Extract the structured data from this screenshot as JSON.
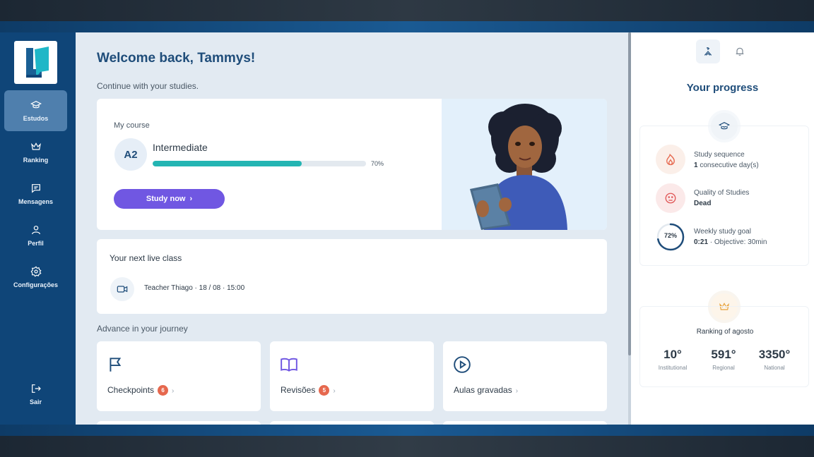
{
  "sidebar": {
    "items": [
      {
        "label": "Estudos",
        "icon": "graduation-cap-icon",
        "active": true
      },
      {
        "label": "Ranking",
        "icon": "crown-icon",
        "active": false
      },
      {
        "label": "Mensagens",
        "icon": "message-icon",
        "active": false
      },
      {
        "label": "Perfil",
        "icon": "user-icon",
        "active": false
      },
      {
        "label": "Configurações",
        "icon": "gear-icon",
        "active": false
      }
    ],
    "logout": {
      "label": "Sair",
      "icon": "logout-icon"
    }
  },
  "main": {
    "welcome": "Welcome back, Tammys!",
    "subtitle": "Continue with your studies.",
    "course": {
      "label": "My course",
      "level_code": "A2",
      "level_name": "Intermediate",
      "progress": 70,
      "progress_label": "70%",
      "cta": "Study now"
    },
    "live_class": {
      "title": "Your next live class",
      "info": "Teacher Thiago · 18 / 08 · 15:00"
    },
    "journey": {
      "title": "Advance in your journey",
      "tiles": [
        {
          "label": "Checkpoints",
          "count": "6",
          "icon": "flag-icon"
        },
        {
          "label": "Revisões",
          "count": "5",
          "icon": "book-icon"
        },
        {
          "label": "Aulas gravadas",
          "count": "",
          "icon": "play-circle-icon"
        }
      ]
    }
  },
  "progress_panel": {
    "title": "Your progress",
    "stats": {
      "sequence_label": "Study sequence",
      "sequence_value": "1",
      "sequence_suffix": " consecutive day(s)",
      "quality_label": "Quality of Studies",
      "quality_value": "Dead",
      "goal_label": "Weekly study goal",
      "goal_value": "0:21",
      "goal_suffix": " · Objective: 30min",
      "goal_pct": "72%",
      "goal_fraction": 0.72
    },
    "ranking": {
      "title": "Ranking of agosto",
      "cols": [
        {
          "value": "10°",
          "label": "Institutional"
        },
        {
          "value": "591°",
          "label": "Regional"
        },
        {
          "value": "3350°",
          "label": "National"
        }
      ]
    }
  },
  "colors": {
    "sidebar": "#0f4578",
    "accent_purple": "#7057e2",
    "progress_teal": "#24b5b3",
    "badge_orange": "#e6684e",
    "title_blue": "#1f4d7a"
  }
}
